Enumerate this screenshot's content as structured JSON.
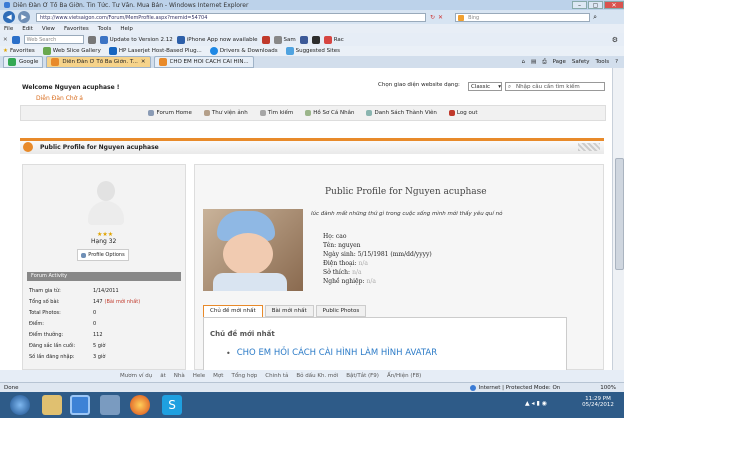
{
  "window": {
    "title": "Diễn Đàn Ở Tổ Ba Giờn. Tin Tức. Tư Vấn. Mua Bán - Windows Internet Explorer",
    "min": "–",
    "max": "▢",
    "close": "✕"
  },
  "address": {
    "url": "http://www.vietsaigon.com/Forum/MemProfile.aspx?memid=54704",
    "search_placeholder": "Bing"
  },
  "menu": [
    "File",
    "Edit",
    "View",
    "Favorites",
    "Tools",
    "Help"
  ],
  "toolbar": {
    "search_box": "Web Search",
    "items": [
      "Update to Version 2.12",
      "iPhone App now available",
      "Sam",
      "Rac"
    ]
  },
  "favorites": {
    "label": "Favorites",
    "items": [
      "Web Slice Gallery",
      "HP Laserjet Host-Based Plug...",
      "Drivers & Downloads",
      "Suggested Sites"
    ]
  },
  "tabs": [
    {
      "label": "Google",
      "active": false
    },
    {
      "label": "Diễn Đàn Ở Tổ Ba Giờn. T...",
      "active": true
    },
    {
      "label": "CHO EM HỎI CÁCH CÀI HÌN...",
      "active": false
    }
  ],
  "tabtools": [
    "Page",
    "Safety",
    "Tools"
  ],
  "header": {
    "welcome": "Welcome Nguyen acuphase !",
    "forum": "Diễn Đàn Chờ ả",
    "choose_label": "Chọn giao diện website dạng:",
    "choose_value": "Classic",
    "search_placeholder": "Nhập câu cần tìm kiếm"
  },
  "nav": [
    "Forum Home",
    "Thư viện ảnh",
    "Tìm kiếm",
    "Hồ Sơ Cá Nhân",
    "Danh Sách Thành Viên",
    "Log out"
  ],
  "profile": {
    "banner": "Public Profile for Nguyen acuphase",
    "heading": "Public Profile for Nguyen acuphase",
    "rank": "Hạng 32",
    "stars": "★★★",
    "options": "Profile Options",
    "activity_title": "Forum Activity",
    "activity": [
      {
        "k": "Tham gia từ:",
        "v": "1/14/2011"
      },
      {
        "k": "Tổng số bài:",
        "v": "147",
        "link": "(Bài mới nhất)"
      },
      {
        "k": "Total Photos:",
        "v": "0"
      },
      {
        "k": "Điểm:",
        "v": "0"
      },
      {
        "k": "Điểm thưởng:",
        "v": "112"
      },
      {
        "k": "Đăng sắc lần cuối:",
        "v": "5 giờ"
      },
      {
        "k": "Số lần đăng nhập:",
        "v": "3 giờ"
      }
    ],
    "quote": "lúc đành mất những thứ gì trong cuộc sống mình mới thấy yêu quí nó",
    "details": [
      {
        "k": "Họ:",
        "v": "cao"
      },
      {
        "k": "Tên:",
        "v": "nguyen"
      },
      {
        "k": "Ngày sinh:",
        "v": "5/15/1981 (mm/dd/yyyy)"
      },
      {
        "k": "Điện thoại:",
        "v": "n/a"
      },
      {
        "k": "Sở thích:",
        "v": "n/a"
      },
      {
        "k": "Nghề nghiệp:",
        "v": "n/a"
      }
    ],
    "subtabs": [
      "Chủ đề mới nhất",
      "Bài mới nhất",
      "Public Photos"
    ],
    "section_title": "Chủ đề mới nhất",
    "topic": "CHO EM HỎI CÁCH CÀI HÌNH LÀM HÌNH AVATAR"
  },
  "findbar": {
    "items": [
      "Mươm ví dụ",
      "ăt",
      "Nhà",
      "Hele",
      "Mợt",
      "Tổng hợp",
      "Chinh tả",
      "Bỏ dấu Kh. mới",
      "Bật/Tắt (F9)",
      "Ấn/Hiện (F8)"
    ]
  },
  "status": {
    "left": "Done",
    "zone": "Internet | Protected Mode: On",
    "zoom": "100%"
  },
  "taskbar": {
    "time": "11:29 PM",
    "date": "05/24/2012"
  },
  "colors": {
    "accent": "#e88a2a",
    "link": "#c0392b",
    "taskbar": "#2e5b88"
  }
}
